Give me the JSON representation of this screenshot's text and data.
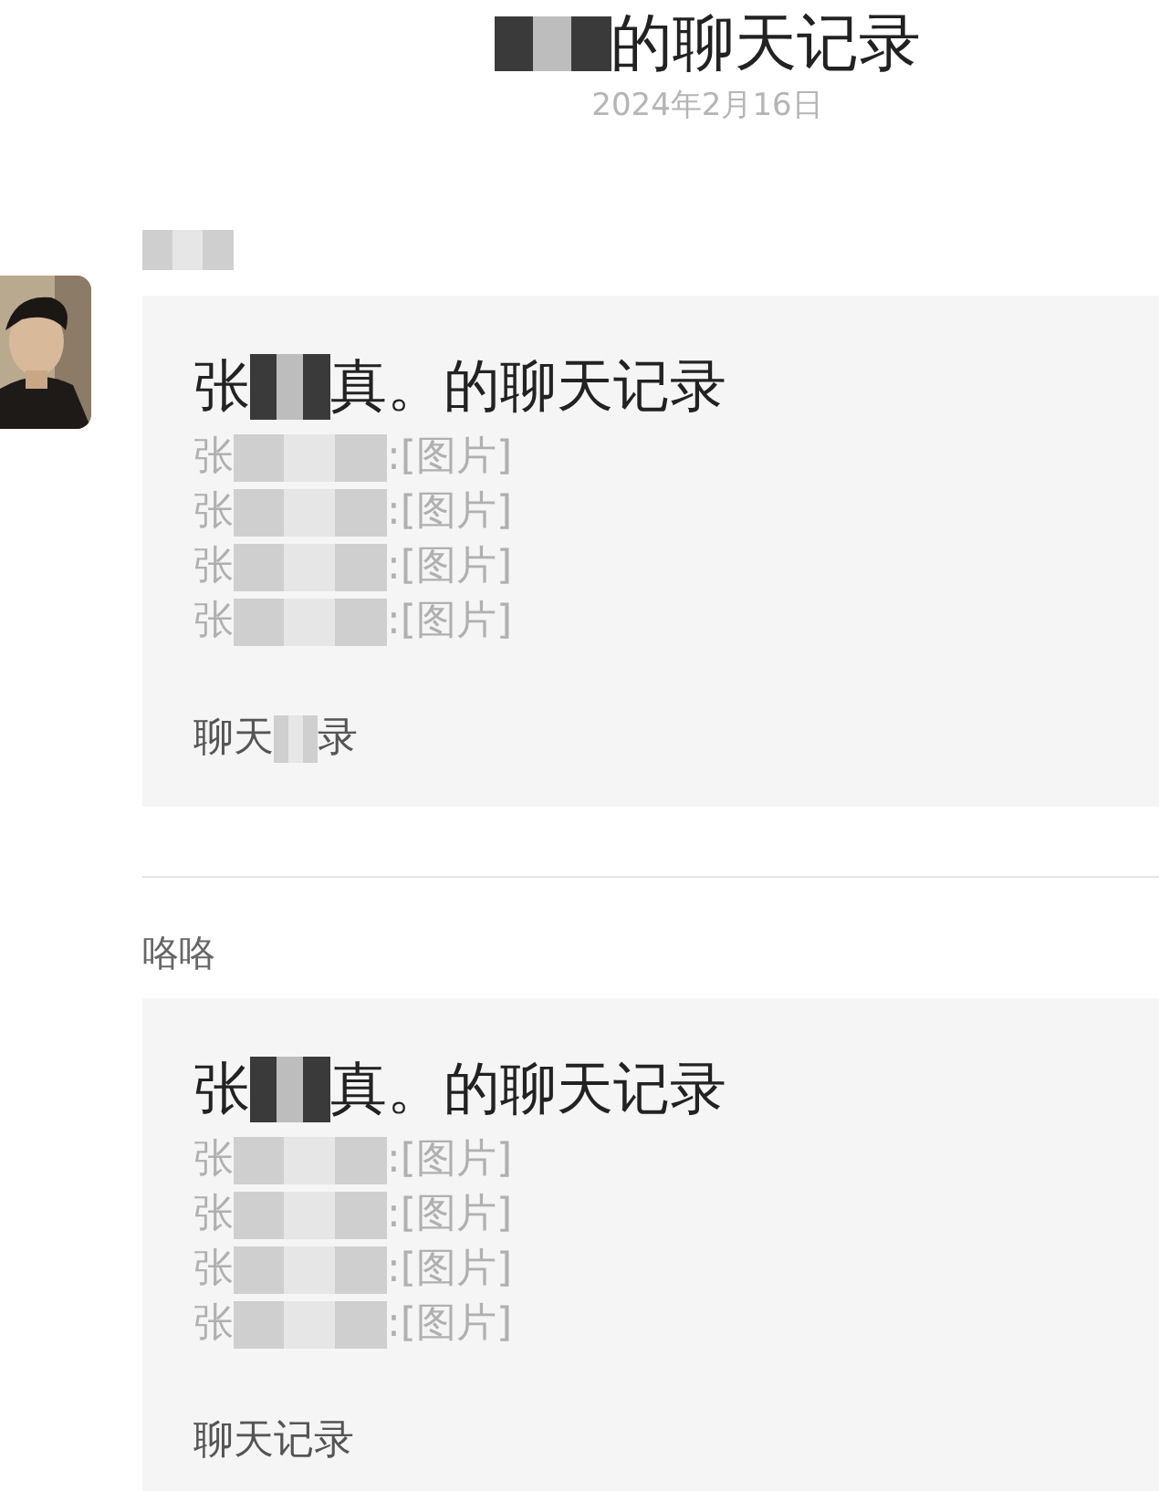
{
  "header": {
    "title": {
      "masked_start": true,
      "parts": [
        "的聊天记录"
      ]
    },
    "date": "2024年2月16日"
  },
  "messages": [
    {
      "sender_masked": true,
      "card": {
        "title": [
          "张",
          "真。的聊天记录"
        ],
        "lines": [
          [
            "张",
            ":[图片]"
          ],
          [
            "张",
            ":[图片]"
          ],
          [
            "张",
            ":[图片]"
          ],
          [
            "张",
            ":[图片]"
          ]
        ],
        "footer": [
          "聊天",
          "录"
        ]
      }
    },
    {
      "sender": "咯咯",
      "card": {
        "title": [
          "张",
          "真。的聊天记录"
        ],
        "lines": [
          [
            "张",
            ":[图片]"
          ],
          [
            "张",
            ":[图片]"
          ],
          [
            "张",
            ":[图片]"
          ],
          [
            "张",
            ":[图片]"
          ]
        ],
        "footer": [
          "聊天记录"
        ]
      }
    }
  ]
}
